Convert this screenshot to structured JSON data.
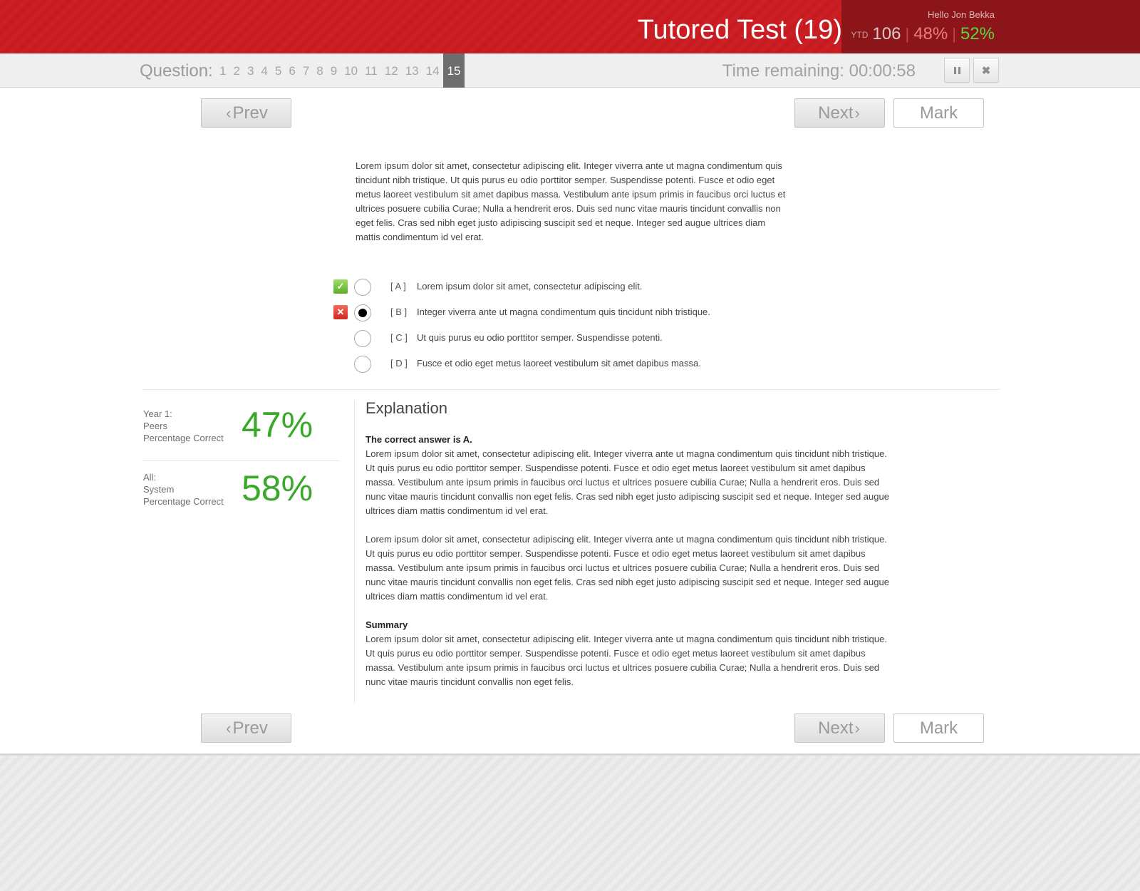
{
  "header": {
    "title": "Tutored Test (19)",
    "greeting": "Hello Jon Bekka",
    "ytd_label": "YTD",
    "ytd_count": "106",
    "pct_incorrect": "48%",
    "pct_correct": "52%",
    "separator": "|"
  },
  "question_nav": {
    "label": "Question:",
    "numbers": [
      "1",
      "2",
      "3",
      "4",
      "5",
      "6",
      "7",
      "8",
      "9",
      "10",
      "11",
      "12",
      "13",
      "14",
      "15"
    ],
    "current": "15",
    "time_label": "Time remaining:",
    "time_value": "00:00:58"
  },
  "buttons": {
    "prev": "Prev",
    "next": "Next",
    "mark": "Mark"
  },
  "question": {
    "text": "Lorem ipsum dolor sit amet, consectetur adipiscing elit. Integer viverra ante ut magna condimentum quis tincidunt nibh tristique. Ut quis purus eu odio porttitor semper. Suspendisse potenti. Fusce et odio eget metus laoreet vestibulum sit amet dapibus massa. Vestibulum ante ipsum primis in faucibus orci luctus et ultrices posuere cubilia Curae; Nulla a hendrerit eros. Duis sed nunc vitae mauris tincidunt convallis non eget felis. Cras sed nibh eget justo adipiscing suscipit sed et neque. Integer sed augue ultrices diam mattis condimentum id vel erat.",
    "answers": [
      {
        "letter": "[ A ]",
        "text": "Lorem ipsum dolor sit amet, consectetur adipiscing elit.",
        "status": "correct",
        "selected": false
      },
      {
        "letter": "[ B ]",
        "text": "Integer viverra ante ut magna condimentum quis tincidunt nibh tristique.",
        "status": "wrong",
        "selected": true
      },
      {
        "letter": "[ C ]",
        "text": "Ut quis purus eu odio porttitor semper. Suspendisse potenti.",
        "status": "",
        "selected": false
      },
      {
        "letter": "[ D ]",
        "text": "Fusce et odio eget metus laoreet vestibulum sit amet dapibus massa.",
        "status": "",
        "selected": false
      }
    ]
  },
  "stats": {
    "peers": {
      "line1": "Year 1:",
      "line2": "Peers",
      "line3": "Percentage Correct",
      "value": "47%"
    },
    "system": {
      "line1": "All:",
      "line2": "System",
      "line3": "Percentage Correct",
      "value": "58%"
    }
  },
  "explanation": {
    "title": "Explanation",
    "correct_heading": "The correct answer is A.",
    "paragraph1": "Lorem ipsum dolor sit amet, consectetur adipiscing elit. Integer viverra ante ut magna condimentum quis tincidunt nibh tristique. Ut quis purus eu odio porttitor semper. Suspendisse potenti. Fusce et odio eget metus laoreet vestibulum sit amet dapibus massa. Vestibulum ante ipsum primis in faucibus orci luctus et ultrices posuere cubilia Curae; Nulla a hendrerit eros. Duis sed nunc vitae mauris tincidunt convallis non eget felis. Cras sed nibh eget justo adipiscing suscipit sed et neque. Integer sed augue ultrices diam mattis condimentum id vel erat.",
    "paragraph2": "Lorem ipsum dolor sit amet, consectetur adipiscing elit. Integer viverra ante ut magna condimentum quis tincidunt nibh tristique. Ut quis purus eu odio porttitor semper. Suspendisse potenti. Fusce et odio eget metus laoreet vestibulum sit amet dapibus massa. Vestibulum ante ipsum primis in faucibus orci luctus et ultrices posuere cubilia Curae; Nulla a hendrerit eros. Duis sed nunc vitae mauris tincidunt convallis non eget felis. Cras sed nibh eget justo adipiscing suscipit sed et neque. Integer sed augue ultrices diam mattis condimentum id vel erat.",
    "summary_heading": "Summary",
    "summary": "Lorem ipsum dolor sit amet, consectetur adipiscing elit. Integer viverra ante ut magna condimentum quis tincidunt nibh tristique. Ut quis purus eu odio porttitor semper. Suspendisse potenti. Fusce et odio eget metus laoreet vestibulum sit amet dapibus massa. Vestibulum ante ipsum primis in faucibus orci luctus et ultrices posuere cubilia Curae; Nulla a hendrerit eros. Duis sed nunc vitae mauris tincidunt convallis non eget felis."
  },
  "icons": {
    "correct": "check-icon",
    "wrong": "cross-icon",
    "pause": "pause-icon",
    "close": "close-icon",
    "prev": "chevron-left-icon",
    "next": "chevron-right-icon"
  },
  "colors": {
    "brand_red": "#cc1f24",
    "user_panel": "#8b1518",
    "stat_green": "#3aa82a",
    "correct_green": "#5fd33f",
    "incorrect_red": "#f07b7e"
  }
}
